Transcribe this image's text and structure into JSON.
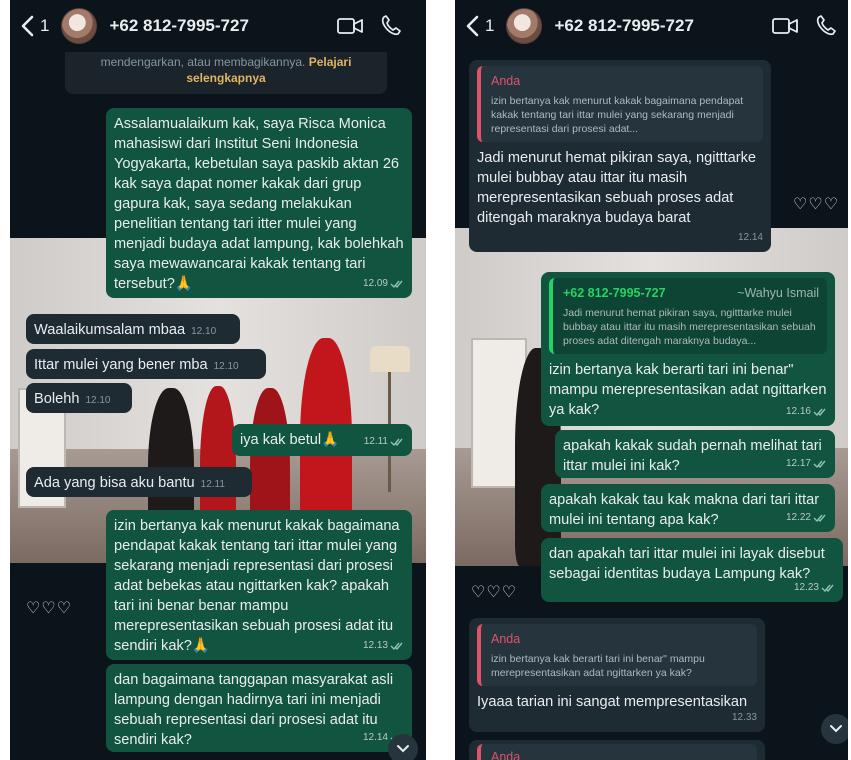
{
  "left": {
    "header": {
      "back_count": "1",
      "contact": "+62 812-7995-727"
    },
    "system_note": {
      "text": "mendengarkan, atau membagikannya.",
      "link": "Pelajari selengkapnya"
    },
    "messages": [
      {
        "text": "Assalamualaikum kak, saya Risca Monica mahasiswi dari Institut Seni Indonesia Yogyakarta, kebetulan saya paskib aktan 26 kak saya dapat nomer kakak dari grup gapura kak, saya sedang melakukan penelitian tentang tari itter mulei yang menjadi budaya adat lampung, kak bolehkah saya mewawancarai kakak tentang tari tersebut?🙏",
        "time": "12.09"
      },
      {
        "text": "Waalaikumsalam mbaa",
        "time": "12.10"
      },
      {
        "text": "Ittar mulei yang bener mba",
        "time": "12.10"
      },
      {
        "text": "Bolehh",
        "time": "12.10"
      },
      {
        "text": "iya kak betul🙏",
        "time": "12.11"
      },
      {
        "text": "Ada yang bisa aku bantu",
        "time": "12.11"
      },
      {
        "text": "izin bertanya kak menurut kakak bagaimana pendapat kakak tentang tari ittar mulei yang sekarang menjadi representasi dari prosesi adat bebekas atau ngittarken kak? apakah tari ini benar benar mampu merepresentasikan sebuah prosesi adat itu sendiri kak?🙏",
        "time": "12.13"
      },
      {
        "text": "dan bagaimana tanggapan masyarakat asli lampung dengan hadirnya tari ini menjadi sebuah representasi dari prosesi adat itu sendiri kak?",
        "time": "12.14"
      }
    ],
    "hearts": "♡♡♡"
  },
  "right": {
    "header": {
      "back_count": "1",
      "contact": "+62 812-7995-727"
    },
    "messages": [
      {
        "quote_author": "Anda",
        "quote_text": "izin bertanya kak menurut kakak bagaimana pendapat kakak tentang tari ittar mulei yang sekarang menjadi representasi dari prosesi adat...",
        "text": "Jadi menurut hemat pikiran saya, ngitttarke mulei bubbay atau ittar itu masih merepresentasikan sebuah proses adat ditengah maraknya budaya barat",
        "time": "12.14"
      },
      {
        "quote_author": "+62 812-7995-727",
        "quote_alias": "~Wahyu Ismail",
        "quote_text": "Jadi menurut hemat pikiran saya, ngitttarke mulei bubbay atau ittar itu masih merepresentasikan sebuah proses adat ditengah maraknya budaya...",
        "text": "izin bertanya kak berarti tari ini benar\" mampu merepresentasikan adat ngittarken ya kak?",
        "time": "12.16"
      },
      {
        "text": "apakah kakak sudah pernah melihat tari ittar mulei ini kak?",
        "time": "12.17"
      },
      {
        "text": "apakah kakak tau kak makna dari tari ittar mulei ini tentang apa kak?",
        "time": "12.22"
      },
      {
        "text": "dan apakah tari ittar mulei ini layak disebut sebagai identitas budaya Lampung kak?",
        "time": "12.23"
      },
      {
        "quote_author": "Anda",
        "quote_text": "izin bertanya kak berarti tari ini benar\" mampu merepresentasikan adat ngittarken ya kak?",
        "text": "Iyaaa tarian ini sangat mempresentasikan",
        "time": "12.33"
      },
      {
        "quote_author": "Anda"
      }
    ],
    "hearts_top": "♡♡♡",
    "hearts_bottom": "♡♡♡"
  },
  "colors": {
    "outgoing": "#11543f",
    "incoming": "#1f2b32",
    "background": "#0b141a",
    "quote_accent": "#e0526a",
    "ticks": "#8fc3b4"
  },
  "icons": [
    "chevron-left-icon",
    "avatar",
    "video-call-icon",
    "phone-icon",
    "double-check-icon",
    "chevron-down-icon"
  ]
}
